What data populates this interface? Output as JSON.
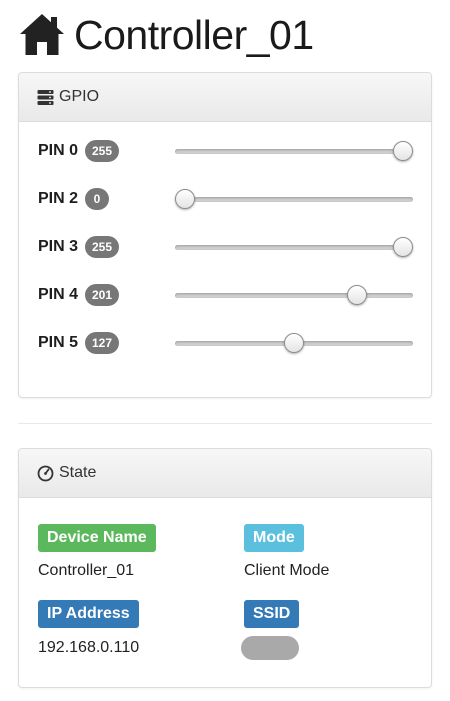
{
  "header": {
    "title": "Controller_01",
    "icon": "home-icon"
  },
  "gpio": {
    "heading": "GPIO",
    "icon": "server-icon",
    "max_value": 255,
    "pins": [
      {
        "label": "PIN 0",
        "value": "255",
        "level": 255
      },
      {
        "label": "PIN 2",
        "value": "0",
        "level": 0
      },
      {
        "label": "PIN 3",
        "value": "255",
        "level": 255
      },
      {
        "label": "PIN 4",
        "value": "201",
        "level": 201
      },
      {
        "label": "PIN 5",
        "value": "127",
        "level": 127
      }
    ]
  },
  "state": {
    "heading": "State",
    "icon": "dashboard-icon",
    "device_name": {
      "label": "Device Name",
      "value": "Controller_01"
    },
    "mode": {
      "label": "Mode",
      "value": "Client Mode"
    },
    "ip_address": {
      "label": "IP Address",
      "value": "192.168.0.110"
    },
    "ssid": {
      "label": "SSID",
      "value": ""
    }
  },
  "colors": {
    "success": "#5cb85c",
    "info": "#5bc0de",
    "primary": "#337ab7",
    "badge": "#777777"
  }
}
